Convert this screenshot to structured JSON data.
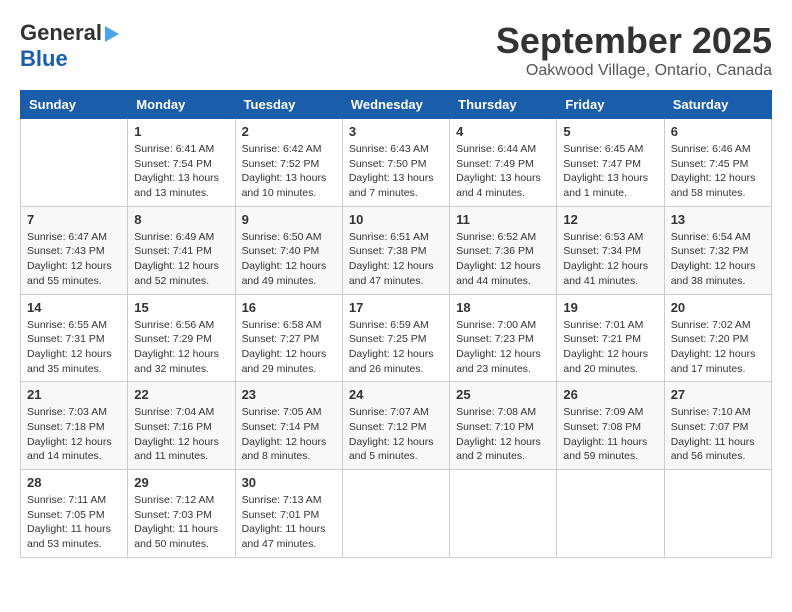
{
  "header": {
    "logo_line1": "General",
    "logo_line2": "Blue",
    "month": "September 2025",
    "location": "Oakwood Village, Ontario, Canada"
  },
  "days_of_week": [
    "Sunday",
    "Monday",
    "Tuesday",
    "Wednesday",
    "Thursday",
    "Friday",
    "Saturday"
  ],
  "weeks": [
    [
      {
        "day": "",
        "sunrise": "",
        "sunset": "",
        "daylight": ""
      },
      {
        "day": "1",
        "sunrise": "Sunrise: 6:41 AM",
        "sunset": "Sunset: 7:54 PM",
        "daylight": "Daylight: 13 hours and 13 minutes."
      },
      {
        "day": "2",
        "sunrise": "Sunrise: 6:42 AM",
        "sunset": "Sunset: 7:52 PM",
        "daylight": "Daylight: 13 hours and 10 minutes."
      },
      {
        "day": "3",
        "sunrise": "Sunrise: 6:43 AM",
        "sunset": "Sunset: 7:50 PM",
        "daylight": "Daylight: 13 hours and 7 minutes."
      },
      {
        "day": "4",
        "sunrise": "Sunrise: 6:44 AM",
        "sunset": "Sunset: 7:49 PM",
        "daylight": "Daylight: 13 hours and 4 minutes."
      },
      {
        "day": "5",
        "sunrise": "Sunrise: 6:45 AM",
        "sunset": "Sunset: 7:47 PM",
        "daylight": "Daylight: 13 hours and 1 minute."
      },
      {
        "day": "6",
        "sunrise": "Sunrise: 6:46 AM",
        "sunset": "Sunset: 7:45 PM",
        "daylight": "Daylight: 12 hours and 58 minutes."
      }
    ],
    [
      {
        "day": "7",
        "sunrise": "Sunrise: 6:47 AM",
        "sunset": "Sunset: 7:43 PM",
        "daylight": "Daylight: 12 hours and 55 minutes."
      },
      {
        "day": "8",
        "sunrise": "Sunrise: 6:49 AM",
        "sunset": "Sunset: 7:41 PM",
        "daylight": "Daylight: 12 hours and 52 minutes."
      },
      {
        "day": "9",
        "sunrise": "Sunrise: 6:50 AM",
        "sunset": "Sunset: 7:40 PM",
        "daylight": "Daylight: 12 hours and 49 minutes."
      },
      {
        "day": "10",
        "sunrise": "Sunrise: 6:51 AM",
        "sunset": "Sunset: 7:38 PM",
        "daylight": "Daylight: 12 hours and 47 minutes."
      },
      {
        "day": "11",
        "sunrise": "Sunrise: 6:52 AM",
        "sunset": "Sunset: 7:36 PM",
        "daylight": "Daylight: 12 hours and 44 minutes."
      },
      {
        "day": "12",
        "sunrise": "Sunrise: 6:53 AM",
        "sunset": "Sunset: 7:34 PM",
        "daylight": "Daylight: 12 hours and 41 minutes."
      },
      {
        "day": "13",
        "sunrise": "Sunrise: 6:54 AM",
        "sunset": "Sunset: 7:32 PM",
        "daylight": "Daylight: 12 hours and 38 minutes."
      }
    ],
    [
      {
        "day": "14",
        "sunrise": "Sunrise: 6:55 AM",
        "sunset": "Sunset: 7:31 PM",
        "daylight": "Daylight: 12 hours and 35 minutes."
      },
      {
        "day": "15",
        "sunrise": "Sunrise: 6:56 AM",
        "sunset": "Sunset: 7:29 PM",
        "daylight": "Daylight: 12 hours and 32 minutes."
      },
      {
        "day": "16",
        "sunrise": "Sunrise: 6:58 AM",
        "sunset": "Sunset: 7:27 PM",
        "daylight": "Daylight: 12 hours and 29 minutes."
      },
      {
        "day": "17",
        "sunrise": "Sunrise: 6:59 AM",
        "sunset": "Sunset: 7:25 PM",
        "daylight": "Daylight: 12 hours and 26 minutes."
      },
      {
        "day": "18",
        "sunrise": "Sunrise: 7:00 AM",
        "sunset": "Sunset: 7:23 PM",
        "daylight": "Daylight: 12 hours and 23 minutes."
      },
      {
        "day": "19",
        "sunrise": "Sunrise: 7:01 AM",
        "sunset": "Sunset: 7:21 PM",
        "daylight": "Daylight: 12 hours and 20 minutes."
      },
      {
        "day": "20",
        "sunrise": "Sunrise: 7:02 AM",
        "sunset": "Sunset: 7:20 PM",
        "daylight": "Daylight: 12 hours and 17 minutes."
      }
    ],
    [
      {
        "day": "21",
        "sunrise": "Sunrise: 7:03 AM",
        "sunset": "Sunset: 7:18 PM",
        "daylight": "Daylight: 12 hours and 14 minutes."
      },
      {
        "day": "22",
        "sunrise": "Sunrise: 7:04 AM",
        "sunset": "Sunset: 7:16 PM",
        "daylight": "Daylight: 12 hours and 11 minutes."
      },
      {
        "day": "23",
        "sunrise": "Sunrise: 7:05 AM",
        "sunset": "Sunset: 7:14 PM",
        "daylight": "Daylight: 12 hours and 8 minutes."
      },
      {
        "day": "24",
        "sunrise": "Sunrise: 7:07 AM",
        "sunset": "Sunset: 7:12 PM",
        "daylight": "Daylight: 12 hours and 5 minutes."
      },
      {
        "day": "25",
        "sunrise": "Sunrise: 7:08 AM",
        "sunset": "Sunset: 7:10 PM",
        "daylight": "Daylight: 12 hours and 2 minutes."
      },
      {
        "day": "26",
        "sunrise": "Sunrise: 7:09 AM",
        "sunset": "Sunset: 7:08 PM",
        "daylight": "Daylight: 11 hours and 59 minutes."
      },
      {
        "day": "27",
        "sunrise": "Sunrise: 7:10 AM",
        "sunset": "Sunset: 7:07 PM",
        "daylight": "Daylight: 11 hours and 56 minutes."
      }
    ],
    [
      {
        "day": "28",
        "sunrise": "Sunrise: 7:11 AM",
        "sunset": "Sunset: 7:05 PM",
        "daylight": "Daylight: 11 hours and 53 minutes."
      },
      {
        "day": "29",
        "sunrise": "Sunrise: 7:12 AM",
        "sunset": "Sunset: 7:03 PM",
        "daylight": "Daylight: 11 hours and 50 minutes."
      },
      {
        "day": "30",
        "sunrise": "Sunrise: 7:13 AM",
        "sunset": "Sunset: 7:01 PM",
        "daylight": "Daylight: 11 hours and 47 minutes."
      },
      {
        "day": "",
        "sunrise": "",
        "sunset": "",
        "daylight": ""
      },
      {
        "day": "",
        "sunrise": "",
        "sunset": "",
        "daylight": ""
      },
      {
        "day": "",
        "sunrise": "",
        "sunset": "",
        "daylight": ""
      },
      {
        "day": "",
        "sunrise": "",
        "sunset": "",
        "daylight": ""
      }
    ]
  ]
}
